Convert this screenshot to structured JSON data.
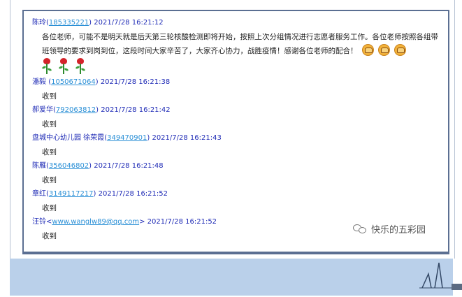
{
  "messages": [
    {
      "sender": "陈玲",
      "qq": "185335221",
      "bracket_open": "(",
      "bracket_close": ")",
      "time": "2021/7/28 16:21:12",
      "body": "各位老师，可能不是明天就是后天第三轮核酸检测即将开始，按照上次分组情况进行志愿者服务工作。各位老师按照各组带班领导的要求到岗到位，这段时间大家辛苦了，大家齐心协力，战胜疫情！感谢各位老师的配合！",
      "emoji_after_text": [
        "fist-icon",
        "fist-icon",
        "fist-icon"
      ],
      "emoji_row": [
        "rose-icon",
        "rose-icon",
        "rose-icon"
      ]
    },
    {
      "sender": "潘毅 ",
      "qq": "1050671064",
      "bracket_open": "(",
      "bracket_close": ")",
      "time": "2021/7/28 16:21:38",
      "body": "收到"
    },
    {
      "sender": "郝爱华",
      "qq": "792063812",
      "bracket_open": "(",
      "bracket_close": ")",
      "time": "2021/7/28 16:21:42",
      "body": "收到"
    },
    {
      "sender": "盘城中心幼儿园  徐荣霞",
      "qq": "349470901",
      "bracket_open": "(",
      "bracket_close": ")",
      "time": "2021/7/28 16:21:43",
      "body": "收到"
    },
    {
      "sender": "陈雁",
      "qq": "356046802",
      "bracket_open": "(",
      "bracket_close": ")",
      "time": "2021/7/28 16:21:48",
      "body": "收到"
    },
    {
      "sender": "章红",
      "qq": "3149117217",
      "bracket_open": "(",
      "bracket_close": ")",
      "time": "2021/7/28 16:21:52",
      "body": "收到"
    },
    {
      "sender": "汪铃",
      "qq": "www.wanglw89@qq.com",
      "bracket_open": "<",
      "bracket_close": ">",
      "time": "2021/7/28 16:21:52",
      "body": "收到"
    }
  ],
  "watermark": {
    "icon": "wechat-icon",
    "text": "快乐的五彩园"
  },
  "colors": {
    "sender": "#1f2bb6",
    "qq_link": "#2a8fd6",
    "window_border": "#5b6f92",
    "bottom_band": "#bad0ea"
  }
}
